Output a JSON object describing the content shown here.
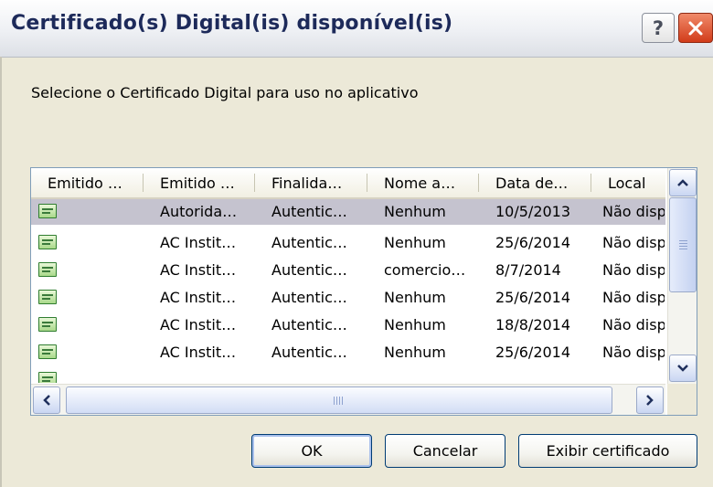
{
  "window": {
    "title": "Certificado(s) Digital(is) disponível(is)",
    "help_label": "?",
    "close_icon": "close-x-icon"
  },
  "instruction": "Selecione o Certificado Digital para uso no aplicativo",
  "table": {
    "columns": [
      "Emitido …",
      "Emitido …",
      "Finalida…",
      "Nome a…",
      "Data de…",
      "Local"
    ],
    "rows": [
      {
        "icon": "certificate-icon",
        "issued_by": "Autorida…",
        "purpose": "Autentic…",
        "friendly_name": "Nenhum",
        "date": "10/5/2013",
        "location": "Não disp",
        "selected": true
      },
      {
        "icon": "certificate-icon",
        "issued_by": "AC Instit…",
        "purpose": "Autentic…",
        "friendly_name": "Nenhum",
        "date": "25/6/2014",
        "location": "Não disp",
        "selected": false
      },
      {
        "icon": "certificate-icon",
        "issued_by": "AC Instit…",
        "purpose": "Autentic…",
        "friendly_name": "comercio…",
        "date": "8/7/2014",
        "location": "Não disp",
        "selected": false
      },
      {
        "icon": "certificate-icon",
        "issued_by": "AC Instit…",
        "purpose": "Autentic…",
        "friendly_name": "Nenhum",
        "date": "25/6/2014",
        "location": "Não disp",
        "selected": false
      },
      {
        "icon": "certificate-icon",
        "issued_by": "AC Instit…",
        "purpose": "Autentic…",
        "friendly_name": "Nenhum",
        "date": "18/8/2014",
        "location": "Não disp",
        "selected": false
      },
      {
        "icon": "certificate-icon",
        "issued_by": "AC Instit…",
        "purpose": "Autentic…",
        "friendly_name": "Nenhum",
        "date": "25/6/2014",
        "location": "Não disp",
        "selected": false
      }
    ]
  },
  "buttons": {
    "ok": "OK",
    "cancel": "Cancelar",
    "view": "Exibir certificado"
  },
  "colors": {
    "selection": "#c5c3cf",
    "title_text": "#1d2a5a",
    "close_button": "#d23c1a"
  }
}
